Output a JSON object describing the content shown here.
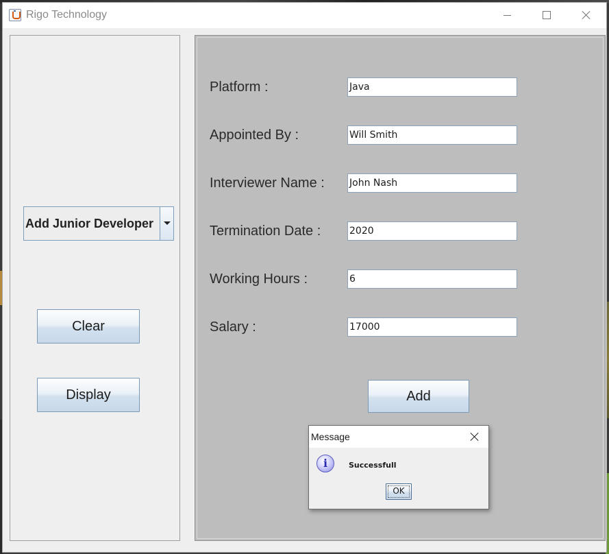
{
  "window": {
    "title": "Rigo Technology",
    "controls": [
      "minimize",
      "maximize",
      "close"
    ]
  },
  "left_panel": {
    "combo_selected": "Add Junior Developer",
    "clear_label": "Clear",
    "display_label": "Display"
  },
  "form": {
    "fields": [
      {
        "label": "Platform :",
        "value": "Java"
      },
      {
        "label": "Appointed By :",
        "value": "Will Smith"
      },
      {
        "label": "Interviewer Name :",
        "value": "John Nash"
      },
      {
        "label": "Termination Date :",
        "value": "2020"
      },
      {
        "label": "Working Hours :",
        "value": "6"
      },
      {
        "label": "Salary :",
        "value": "17000"
      }
    ],
    "add_label": "Add"
  },
  "dialog": {
    "title": "Message",
    "message": "Successfull",
    "ok_label": "OK",
    "icon": "info-icon"
  },
  "colors": {
    "form_panel_bg": "#bdbdbd",
    "window_bg": "#efefef",
    "button_border": "#7a99b6"
  }
}
